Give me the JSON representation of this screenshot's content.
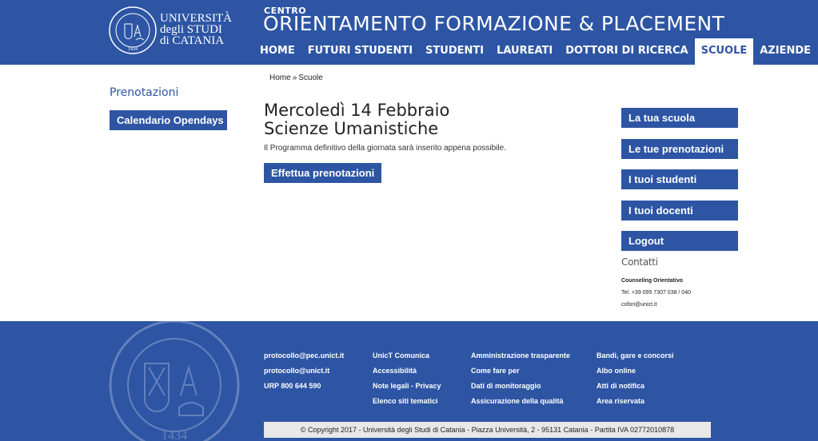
{
  "header": {
    "logo_lines": [
      "UNIVERSITÀ",
      "degli STUDI",
      "di CATANIA"
    ],
    "logo_seal_year": "1434",
    "super_title": "CENTRO",
    "title": "ORIENTAMENTO FORMAZIONE & PLACEMENT",
    "nav": [
      {
        "label": "HOME",
        "active": false
      },
      {
        "label": "FUTURI STUDENTI",
        "active": false
      },
      {
        "label": "STUDENTI",
        "active": false
      },
      {
        "label": "LAUREATI",
        "active": false
      },
      {
        "label": "DOTTORI DI RICERCA",
        "active": false
      },
      {
        "label": "SCUOLE",
        "active": true
      },
      {
        "label": "AZIENDE",
        "active": false
      }
    ]
  },
  "sidebar_left": {
    "heading": "Prenotazioni",
    "button": "Calendario Opendays"
  },
  "breadcrumb": {
    "home": "Home",
    "separator": "»",
    "current": "Scuole"
  },
  "main": {
    "title_line1": "Mercoledì 14 Febbraio",
    "title_line2": "Scienze Umanistiche",
    "description": "Il Programma definitivo della giornata sarà inserito appena possibile.",
    "button": "Effettua prenotazioni"
  },
  "sidebar_right": {
    "buttons": [
      "La tua scuola",
      "Le tue prenotazioni",
      "I tuoi studenti",
      "I tuoi docenti",
      "Logout"
    ],
    "contacts_heading": "Contatti",
    "contact_name": "Counseling Orientativo",
    "contact_tel": "Tel. +39 095 7307 038 / 040",
    "contact_email": "cofori@unict.it"
  },
  "footer": {
    "col1": [
      "protocollo@pec.unict.it",
      "protocollo@unict.it",
      "URP 800 644 590"
    ],
    "col2": [
      "UnicT Comunica",
      "Accessibilità",
      "Note legali - Privacy",
      "Elenco siti tematici"
    ],
    "col3": [
      "Amministrazione trasparente",
      "Come fare per",
      "Dati di monitoraggio",
      "Assicurazione della qualità"
    ],
    "col4": [
      "Bandi, gare e concorsi",
      "Albo online",
      "Atti di notifica",
      "Area riservata"
    ],
    "copyright": "© Copyright 2017 - Università degli Studi di Catania - Piazza Università, 2 - 95131 Catania - Partita IVA 02772010878"
  },
  "colors": {
    "brand_blue": "#2d55a4",
    "white": "#ffffff",
    "copyright_bg": "#e8e8e8"
  }
}
